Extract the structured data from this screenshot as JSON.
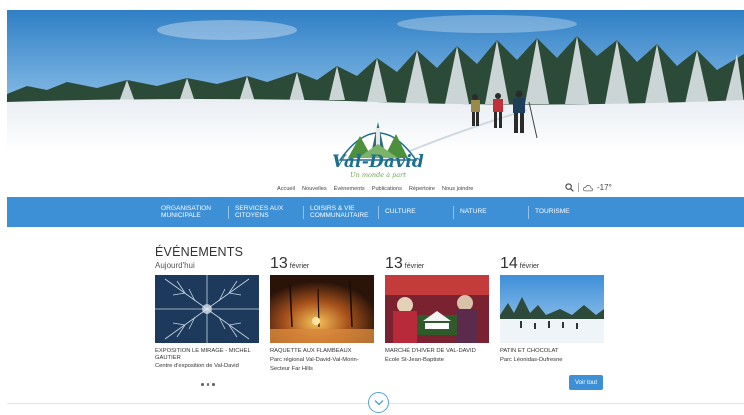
{
  "brand": {
    "name": "Val-David",
    "tagline": "Un monde à part"
  },
  "top_nav": [
    "Accueil",
    "Nouvelles",
    "Événements",
    "Publications",
    "Répertoire",
    "Nous joindre"
  ],
  "weather": {
    "temperature": "-17°"
  },
  "main_nav": [
    {
      "label": "ORGANISATION MUNICIPALE"
    },
    {
      "label": "SERVICES AUX CITOYENS"
    },
    {
      "label": "LOISIRS & VIE COMMUNAUTAIRE"
    },
    {
      "label": "CULTURE"
    },
    {
      "label": "NATURE"
    },
    {
      "label": "TOURISME"
    }
  ],
  "events": {
    "title": "ÉVÉNEMENTS",
    "subtitle": "Aujourd'hui",
    "view_all": "Voir tout",
    "items": [
      {
        "day": "",
        "month": "",
        "title": "EXPOSITION LE MIRAGE - MICHEL GAUTIER",
        "place": "Centre d'exposition de Val-David"
      },
      {
        "day": "13",
        "month": "février",
        "title": "RAQUETTE AUX FLAMBEAUX",
        "place": "Parc régional Val-David-Val-Morin-Secteur Far Hills"
      },
      {
        "day": "13",
        "month": "février",
        "title": "MARCHÉ D'HIVER DE VAL-DAVID",
        "place": "École St-Jean-Baptiste"
      },
      {
        "day": "14",
        "month": "février",
        "title": "PATIN ET CHOCOLAT",
        "place": "Parc Léonidas-Dufresne"
      }
    ]
  },
  "icons": {
    "search": "search-icon",
    "weather": "weather-icon",
    "scroll": "chevron-down-icon"
  },
  "colors": {
    "nav_blue": "#3d8fd6",
    "logo_blue": "#1e6f8e",
    "logo_green": "#6aa84f"
  }
}
